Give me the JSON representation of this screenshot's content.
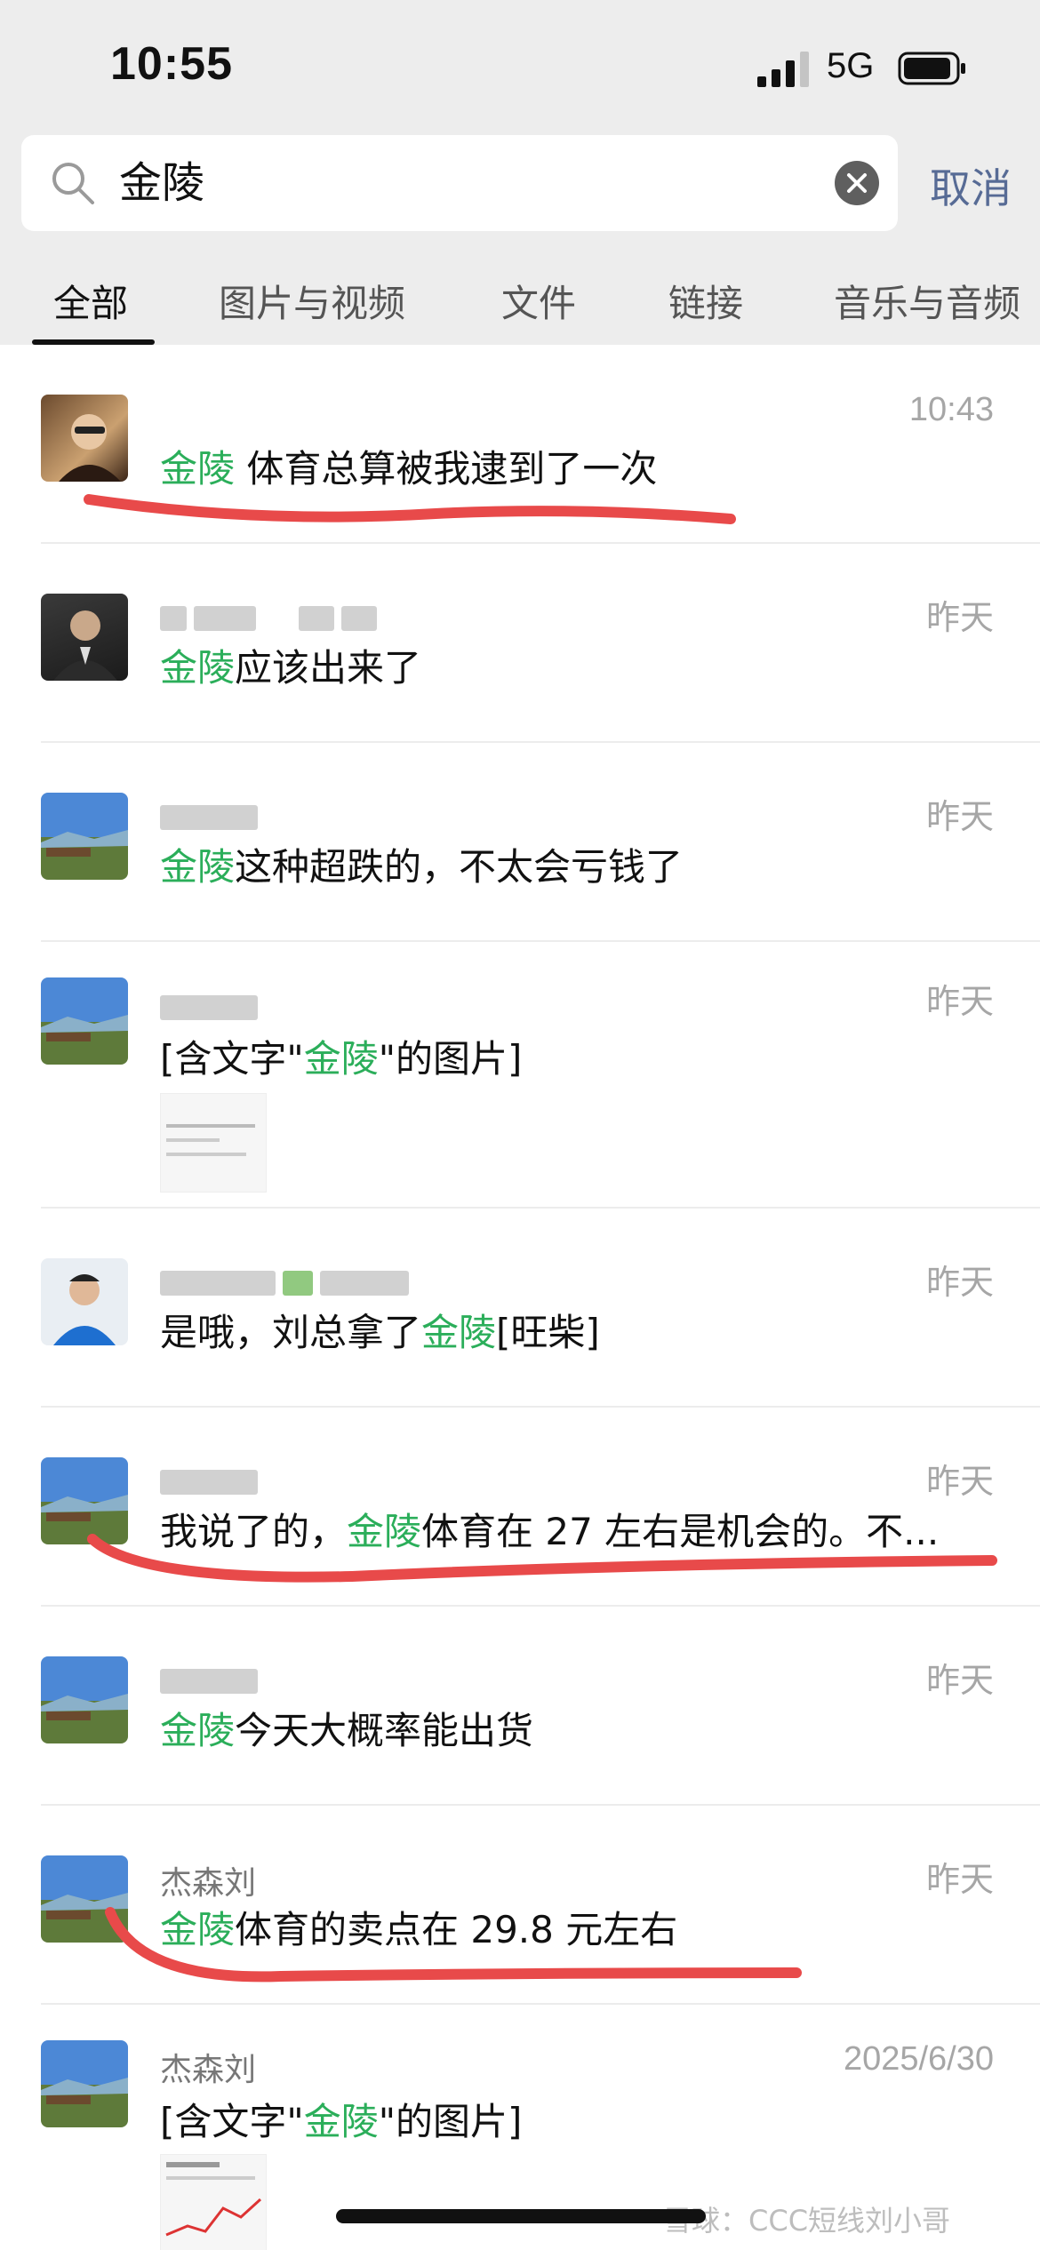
{
  "status_bar": {
    "time": "10:55",
    "network": "5G"
  },
  "search": {
    "query": "金陵",
    "cancel_label": "取消"
  },
  "tabs": [
    {
      "label": "全部",
      "active": true
    },
    {
      "label": "图片与视频",
      "active": false
    },
    {
      "label": "文件",
      "active": false
    },
    {
      "label": "链接",
      "active": false
    },
    {
      "label": "音乐与音频",
      "active": false
    }
  ],
  "results": [
    {
      "name": "",
      "time": "10:43",
      "pre": "",
      "keyword": "金陵",
      "post": " 体育总算被我逮到了一次"
    },
    {
      "name": "",
      "time": "昨天",
      "pre": "",
      "keyword": "金陵",
      "post": "应该出来了"
    },
    {
      "name": "",
      "time": "昨天",
      "pre": "",
      "keyword": "金陵",
      "post": "这种超跌的，不太会亏钱了"
    },
    {
      "name": "",
      "time": "昨天",
      "pre": "[含文字\"",
      "keyword": "金陵",
      "post": "\"的图片]"
    },
    {
      "name": "",
      "time": "昨天",
      "pre": "是哦，刘总拿了",
      "keyword": "金陵",
      "post": "[旺柴]"
    },
    {
      "name": "",
      "time": "昨天",
      "pre": "我说了的，",
      "keyword": "金陵",
      "post": "体育在 27 左右是机会的。不..."
    },
    {
      "name": "",
      "time": "昨天",
      "pre": "",
      "keyword": "金陵",
      "post": "今天大概率能出货"
    },
    {
      "name": "杰森刘",
      "time": "昨天",
      "pre": "",
      "keyword": "金陵",
      "post": "体育的卖点在 29.8 元左右"
    },
    {
      "name": "杰森刘",
      "time": "2025/6/30",
      "pre": "[含文字\"",
      "keyword": "金陵",
      "post": "\"的图片]"
    }
  ],
  "watermark": "雪球：CCC短线刘小哥",
  "colors": {
    "highlight": "#2bae5a",
    "cancel": "#576b95",
    "annotation": "#e84a4a"
  }
}
